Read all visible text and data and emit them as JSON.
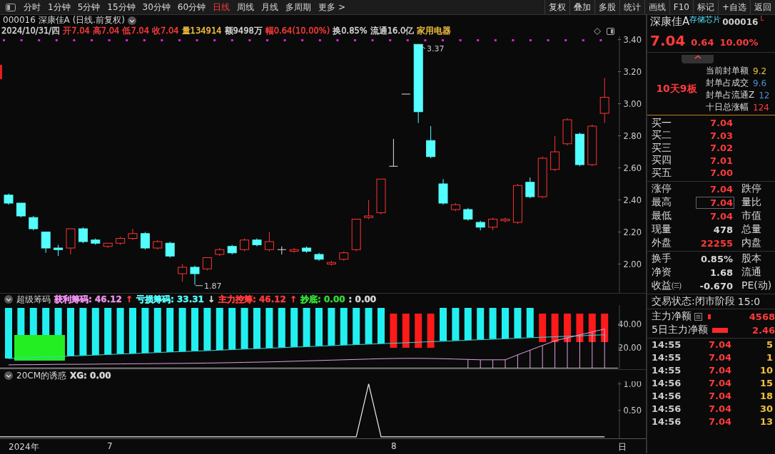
{
  "toolbar": {
    "periods": [
      {
        "label": "分时",
        "selected": false
      },
      {
        "label": "1分钟",
        "selected": false
      },
      {
        "label": "5分钟",
        "selected": false
      },
      {
        "label": "15分钟",
        "selected": false
      },
      {
        "label": "30分钟",
        "selected": false
      },
      {
        "label": "60分钟",
        "selected": false
      },
      {
        "label": "日线",
        "selected": true
      },
      {
        "label": "周线",
        "selected": false
      },
      {
        "label": "月线",
        "selected": false
      },
      {
        "label": "多周期",
        "selected": false
      },
      {
        "label": "更多 >",
        "selected": false
      }
    ],
    "buttons": [
      "复权",
      "叠加",
      "多股",
      "统计",
      "画线",
      "F10",
      "标记",
      "+自选",
      "返回"
    ]
  },
  "quote_header": {
    "title": "000016 深康佳A (日线.前复权)",
    "fields": [
      {
        "text": "2024/10/31/四",
        "color": "#d8d8d8"
      },
      {
        "text": "开7.04",
        "color": "#ff3b3b"
      },
      {
        "text": "高7.04",
        "color": "#ff3b3b"
      },
      {
        "text": "低7.04",
        "color": "#ff3b3b"
      },
      {
        "text": "收7.04",
        "color": "#ff3b3b"
      },
      {
        "text": "量134914",
        "color": "#f2c040"
      },
      {
        "text": "额9498万",
        "color": "#d8d8d8"
      },
      {
        "text": "幅0.64(10.00%)",
        "color": "#ff3b3b"
      },
      {
        "text": "换0.85%",
        "color": "#d8d8d8"
      },
      {
        "text": "流通16.0亿",
        "color": "#d8d8d8"
      },
      {
        "text": "家用电器",
        "color": "#f2c040"
      }
    ]
  },
  "price_chart": {
    "high_label": "3.37",
    "low_label": "1.87",
    "chart_data": {
      "type": "candlestick",
      "categories": [
        null,
        null,
        null,
        null,
        null,
        null,
        null,
        null,
        null,
        null,
        null,
        null,
        null,
        null,
        null,
        null,
        null,
        null,
        null,
        null,
        null,
        null,
        null,
        null,
        null,
        null,
        null,
        null,
        null,
        null,
        null,
        null,
        null,
        null,
        null,
        null,
        null,
        null,
        null,
        null,
        null,
        null,
        null,
        null,
        null,
        null,
        null,
        null,
        null
      ],
      "ylim": [
        1.82,
        3.42
      ],
      "yticks": [
        {
          "value": 3.4,
          "label": "3.40"
        },
        {
          "value": 3.2,
          "label": "3.20"
        },
        {
          "value": 3.0,
          "label": "3.00"
        },
        {
          "value": 2.8,
          "label": "2.80"
        },
        {
          "value": 2.6,
          "label": "2.60"
        },
        {
          "value": 2.4,
          "label": "2.40"
        },
        {
          "value": 2.2,
          "label": "2.20"
        },
        {
          "value": 2.0,
          "label": "2.00"
        }
      ],
      "ohlc": [
        [
          2.43,
          2.44,
          2.37,
          2.38
        ],
        [
          2.38,
          2.38,
          2.29,
          2.3
        ],
        [
          2.29,
          2.3,
          2.21,
          2.22
        ],
        [
          2.2,
          2.2,
          2.07,
          2.1
        ],
        [
          2.1,
          2.12,
          2.05,
          2.09
        ],
        [
          2.1,
          2.22,
          2.06,
          2.22
        ],
        [
          2.22,
          2.23,
          2.13,
          2.14
        ],
        [
          2.15,
          2.16,
          2.12,
          2.13
        ],
        [
          2.11,
          2.13,
          2.1,
          2.13
        ],
        [
          2.13,
          2.17,
          2.12,
          2.16
        ],
        [
          2.16,
          2.22,
          2.15,
          2.19
        ],
        [
          2.19,
          2.2,
          2.09,
          2.1
        ],
        [
          2.1,
          2.15,
          2.09,
          2.14
        ],
        [
          2.13,
          2.14,
          2.04,
          2.05
        ],
        [
          1.94,
          2.0,
          1.89,
          1.98
        ],
        [
          1.98,
          1.99,
          1.87,
          1.94
        ],
        [
          1.97,
          2.04,
          1.96,
          2.04
        ],
        [
          2.06,
          2.1,
          2.05,
          2.09
        ],
        [
          2.11,
          2.12,
          2.06,
          2.07
        ],
        [
          2.09,
          2.16,
          2.08,
          2.15
        ],
        [
          2.15,
          2.16,
          2.11,
          2.12
        ],
        [
          2.09,
          2.2,
          2.08,
          2.14
        ],
        [
          2.09,
          2.11,
          2.06,
          2.09
        ],
        [
          2.08,
          2.1,
          2.07,
          2.09
        ],
        [
          2.1,
          2.11,
          2.07,
          2.08
        ],
        [
          2.06,
          2.07,
          2.02,
          2.03
        ],
        [
          2.0,
          2.02,
          1.99,
          2.01
        ],
        [
          2.03,
          2.08,
          2.02,
          2.07
        ],
        [
          2.09,
          2.28,
          2.08,
          2.28
        ],
        [
          2.29,
          2.4,
          2.28,
          2.3
        ],
        [
          2.32,
          2.53,
          2.31,
          2.53
        ],
        [
          2.61,
          2.78,
          2.61,
          2.61
        ],
        [
          3.06,
          3.06,
          3.06,
          3.06
        ],
        [
          3.37,
          3.37,
          2.88,
          2.95
        ],
        [
          2.77,
          2.86,
          2.66,
          2.67
        ],
        [
          2.5,
          2.53,
          2.37,
          2.38
        ],
        [
          2.34,
          2.38,
          2.33,
          2.37
        ],
        [
          2.34,
          2.35,
          2.27,
          2.28
        ],
        [
          2.26,
          2.27,
          2.21,
          2.23
        ],
        [
          2.23,
          2.29,
          2.21,
          2.28
        ],
        [
          2.27,
          2.29,
          2.26,
          2.28
        ],
        [
          2.26,
          2.5,
          2.25,
          2.49
        ],
        [
          2.51,
          2.54,
          2.41,
          2.42
        ],
        [
          2.42,
          2.67,
          2.41,
          2.66
        ],
        [
          2.59,
          2.8,
          2.58,
          2.7
        ],
        [
          2.75,
          2.91,
          2.74,
          2.9
        ],
        [
          2.81,
          2.82,
          2.61,
          2.62
        ],
        [
          2.62,
          2.87,
          2.61,
          2.86
        ],
        [
          2.94,
          3.16,
          2.88,
          3.04
        ]
      ]
    }
  },
  "indicators": [
    {
      "title": "超级筹码",
      "fields": [
        {
          "text": "获利筹码: 46.12",
          "color": "#ee90ee"
        },
        {
          "text": "↑",
          "color": "#ff3b3b"
        },
        {
          "text": "亏损筹码: 33.31",
          "color": "#55ffff"
        },
        {
          "text": "↓",
          "color": "#d8d8d8"
        },
        {
          "text": "主力控筹: 46.12",
          "color": "#ff3b3b"
        },
        {
          "text": "↑",
          "color": "#ff3b3b"
        },
        {
          "text": "抄底: 0.00",
          "color": "#33dd33"
        },
        {
          "text": ": 0.00",
          "color": "#d8d8d8"
        }
      ],
      "chart_data": {
        "type": "line",
        "ylim": [
          1.8,
          56.4
        ],
        "yticks": [
          {
            "value": 40,
            "label": "40.00"
          },
          {
            "value": 20,
            "label": "20.00"
          }
        ],
        "series": [
          {
            "color": "#30d8d8",
            "values": [
              10.9,
              11.3,
              11.7,
              12.2,
              12.6,
              13.0,
              13.4,
              13.8,
              14.3,
              14.7,
              15.1,
              15.5,
              16.0,
              16.4,
              16.8,
              17.2,
              17.6,
              18.0,
              18.5,
              18.9,
              19.3,
              19.7,
              20.1,
              20.6,
              21.0,
              21.4,
              21.8,
              22.3,
              22.7,
              23.1,
              23.5,
              23.9,
              24.3,
              24.8,
              25.2,
              25.6,
              26.0,
              26.5,
              26.9,
              27.3,
              27.7,
              28.1,
              28.6,
              29.0,
              29.4,
              29.8,
              30.2,
              30.7,
              31.1
            ]
          },
          {
            "color": "#e0a0e0",
            "values": [
              5.5,
              5.6,
              5.7,
              5.8,
              5.9,
              6.0,
              6.0,
              6.1,
              6.2,
              6.3,
              6.4,
              6.5,
              6.6,
              6.7,
              6.8,
              6.9,
              7.0,
              7.2,
              7.4,
              7.6,
              7.8,
              8.0,
              8.3,
              8.6,
              8.9,
              9.2,
              9.5,
              9.8,
              10.1,
              10.4,
              10.7,
              10.9,
              11.0,
              11.0,
              10.9,
              10.7,
              10.4,
              10.1,
              9.8,
              9.8,
              9.8,
              14.0,
              18.0,
              22.0,
              26.0,
              28.5,
              31.0,
              33.5,
              36.0
            ]
          }
        ]
      }
    },
    {
      "title": "20CM的诱惑",
      "fields": [
        {
          "text": "XG: 0.00",
          "color": "#d8d8d8"
        }
      ],
      "chart_data": {
        "type": "line",
        "ylim": [
          -0.03,
          1.05
        ],
        "yticks": [
          {
            "value": 1,
            "label": "1.00"
          },
          {
            "value": 0.5,
            "label": "0.50"
          }
        ],
        "series": [
          {
            "color": "#eeeeee",
            "values": [
              0,
              0,
              0,
              0,
              0,
              0,
              0,
              0,
              0,
              0,
              0,
              0,
              0,
              0,
              0,
              0,
              0,
              0,
              0,
              0,
              0,
              0,
              0,
              0,
              0,
              0,
              0,
              0,
              0,
              1,
              0,
              0,
              0,
              0,
              0,
              0,
              0,
              0,
              0,
              0,
              0,
              0,
              0,
              0,
              0,
              0,
              0,
              0,
              0
            ]
          }
        ]
      }
    }
  ],
  "x_axis": [
    "2024年",
    "7",
    "8",
    "日"
  ],
  "side_panel": {
    "stock": {
      "name": "深康佳A",
      "concept": "存储芯片",
      "code": "000016",
      "flag": "L"
    },
    "quote": {
      "price": "7.04",
      "change": "0.64",
      "percent": "10.00%"
    },
    "streak": "10天9板",
    "seal_stats": [
      {
        "label": "当前封单额",
        "value": "9.2",
        "color": "#f2c040"
      },
      {
        "label": "封单占成交",
        "value": "9.6",
        "color": "#4d8fd8"
      },
      {
        "label": "封单占流通Z",
        "value": "12",
        "color": "#4d8fd8"
      },
      {
        "label": "十日总涨幅",
        "value": "124",
        "color": "#ff3b3b"
      }
    ],
    "bids": [
      {
        "label": "买一",
        "price": "7.04"
      },
      {
        "label": "买二",
        "price": "7.03"
      },
      {
        "label": "买三",
        "price": "7.02"
      },
      {
        "label": "买四",
        "price": "7.01"
      },
      {
        "label": "买五",
        "price": "7.00"
      }
    ],
    "stats": [
      {
        "label": "涨停",
        "value": "7.04",
        "color": "#ff3b3b",
        "label2": "跌停",
        "highlighted": false
      },
      {
        "label": "最高",
        "value": "7.04",
        "color": "#ff3b3b",
        "label2": "量比",
        "highlighted": true
      },
      {
        "label": "最低",
        "value": "7.04",
        "color": "#ff3b3b",
        "label2": "市值",
        "highlighted": false
      },
      {
        "label": "现量",
        "value": "478",
        "color": "#d8d8d8",
        "label2": "总量",
        "highlighted": false
      },
      {
        "label": "外盘",
        "value": "22255",
        "color": "#ff3b3b",
        "label2": "内盘",
        "highlighted": false
      }
    ],
    "stats2": [
      {
        "label": "换手",
        "value": "0.85%",
        "label2": "股本"
      },
      {
        "label": "净资",
        "value": "1.68",
        "label2": "流通"
      },
      {
        "label": "收益㈢",
        "value": "-0.670",
        "label2": "PE(动)"
      }
    ],
    "trade_status": {
      "label": "交易状态:",
      "value": "闭市阶段",
      "time": "15:0"
    },
    "flows": [
      {
        "label": "主力净额",
        "value": "4568",
        "kind": "note"
      },
      {
        "label": "5日主力净额",
        "value": "2.46",
        "kind": "plain"
      }
    ],
    "trades": [
      {
        "time": "14:55",
        "price": "7.04",
        "volume": "5"
      },
      {
        "time": "14:55",
        "price": "7.04",
        "volume": "1"
      },
      {
        "time": "14:55",
        "price": "7.04",
        "volume": "10"
      },
      {
        "time": "14:56",
        "price": "7.04",
        "volume": "15"
      },
      {
        "time": "14:56",
        "price": "7.04",
        "volume": "18"
      },
      {
        "time": "14:56",
        "price": "7.04",
        "volume": "30"
      },
      {
        "time": "14:56",
        "price": "7.04",
        "volume": "13"
      }
    ]
  }
}
